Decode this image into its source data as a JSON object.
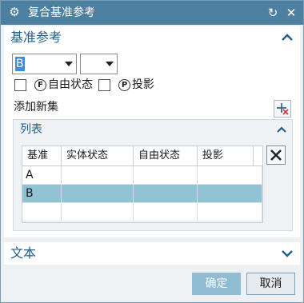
{
  "window": {
    "title": "复合基准参考"
  },
  "datum_section": {
    "title": "基准参考",
    "primary_combo_value": "B",
    "secondary_combo_value": "",
    "free_state": {
      "symbol": "F",
      "label": "自由状态"
    },
    "projected": {
      "symbol": "P",
      "label": "投影"
    },
    "add_set_label": "添加新集"
  },
  "list_section": {
    "title": "列表",
    "columns": [
      "基准",
      "实体状态",
      "自由状态",
      "投影"
    ],
    "rows": [
      {
        "datum": "A",
        "material": "",
        "free": "",
        "proj": ""
      },
      {
        "datum": "B",
        "material": "",
        "free": "",
        "proj": ""
      }
    ]
  },
  "text_section": {
    "title": "文本"
  },
  "buttons": {
    "ok": "确定",
    "cancel": "取消"
  },
  "colors": {
    "titlebar": "#4d7f9f",
    "section_title": "#1f5f8a",
    "row_selected": "#90c3d3",
    "ok_button": "#8fbcd2"
  }
}
